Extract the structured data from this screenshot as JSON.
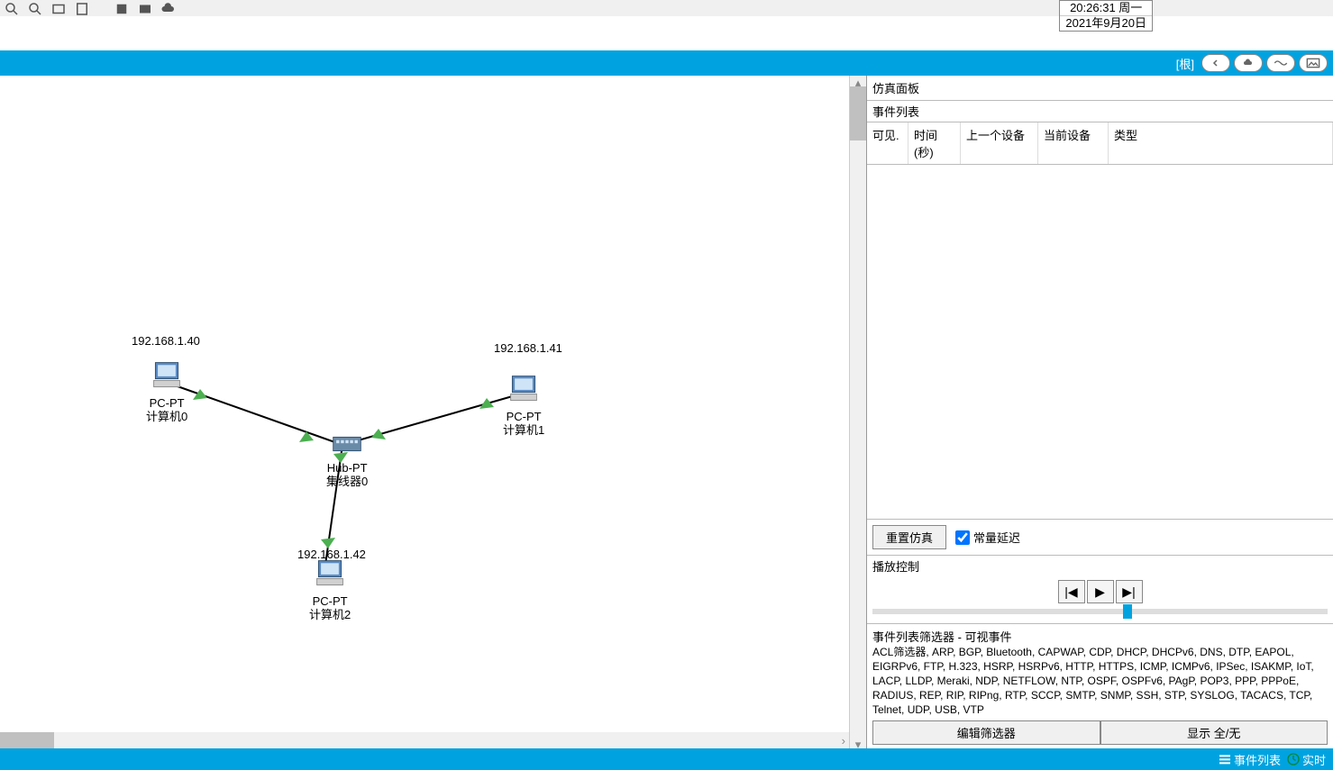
{
  "datetime": {
    "time": "20:26:31 周一",
    "date": "2021年9月20日"
  },
  "bluebar": {
    "root": "[根]"
  },
  "topology": {
    "nodes": {
      "pc0": {
        "ip": "192.168.1.40",
        "type": "PC-PT",
        "name": "计算机0"
      },
      "pc1": {
        "ip": "192.168.1.41",
        "type": "PC-PT",
        "name": "计算机1"
      },
      "pc2": {
        "ip": "192.168.1.42",
        "type": "PC-PT",
        "name": "计算机2"
      },
      "hub": {
        "type": "Hub-PT",
        "name": "集线器0"
      }
    }
  },
  "panel": {
    "title": "仿真面板",
    "event_list_title": "事件列表",
    "columns": {
      "c0": "可见.",
      "c1": "时间(秒)",
      "c2": "上一个设备",
      "c3": "当前设备",
      "c4": "类型"
    },
    "reset_btn": "重置仿真",
    "const_delay": "常量延迟",
    "play_title": "播放控制",
    "filter_title": "事件列表筛选器 - 可视事件",
    "protocols": "ACL筛选器, ARP, BGP, Bluetooth, CAPWAP, CDP, DHCP, DHCPv6, DNS, DTP, EAPOL, EIGRPv6, FTP, H.323, HSRP, HSRPv6, HTTP, HTTPS, ICMP, ICMPv6, IPSec, ISAKMP, IoT, LACP, LLDP, Meraki, NDP, NETFLOW, NTP, OSPF, OSPFv6, PAgP, POP3, PPP, PPPoE, RADIUS, REP, RIP, RIPng, RTP, SCCP, SMTP, SNMP, SSH, STP, SYSLOG, TACACS, TCP, Telnet, UDP, USB, VTP",
    "edit_filter_btn": "编辑筛选器",
    "show_all_btn": "显示 全/无"
  },
  "statusbar": {
    "event_list": "事件列表",
    "realtime": "实时"
  }
}
